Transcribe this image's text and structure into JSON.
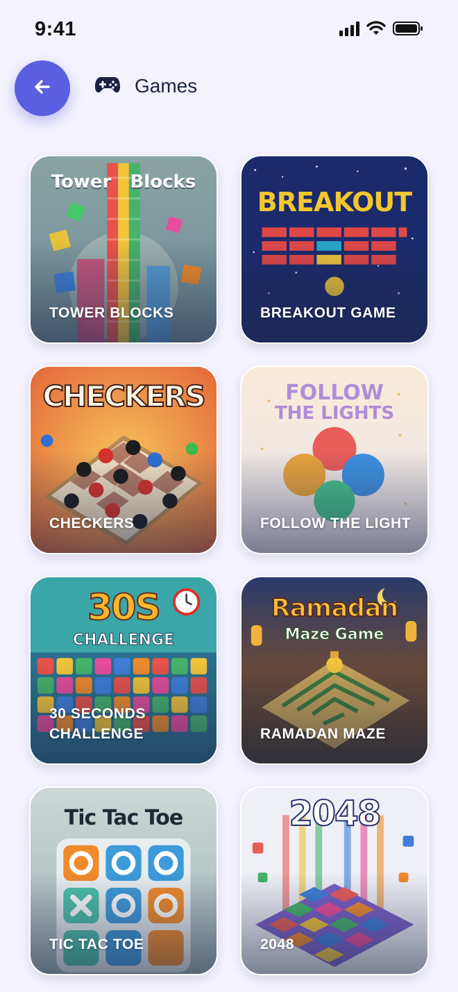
{
  "status_bar": {
    "time": "9:41"
  },
  "header": {
    "title": "Games",
    "icon": "gamepad-icon",
    "back_icon": "arrow-left-icon"
  },
  "colors": {
    "accent": "#5a5ee0",
    "background": "#f3f2fd"
  },
  "games": [
    {
      "label": "TOWER BLOCKS",
      "art_title": "Tower   Blocks"
    },
    {
      "label": "BREAKOUT GAME",
      "art_title": "BREAKOUT"
    },
    {
      "label": "CHECKERS",
      "art_title": "CHECKERS"
    },
    {
      "label": "FOLLOW THE LIGHT",
      "art_title_1": "FOLLOW",
      "art_title_2": "THE LIGHTS"
    },
    {
      "label": "30 SECONDS CHALLENGE",
      "art_title_1": "30S",
      "art_title_2": "CHALLENGE"
    },
    {
      "label": "RAMADAN MAZE",
      "art_title_1": "Ramadan",
      "art_title_2": "Maze Game"
    },
    {
      "label": "TIC TAC TOE",
      "art_title": "Tic Tac Toe"
    },
    {
      "label": "2048",
      "art_title": "2048"
    }
  ]
}
